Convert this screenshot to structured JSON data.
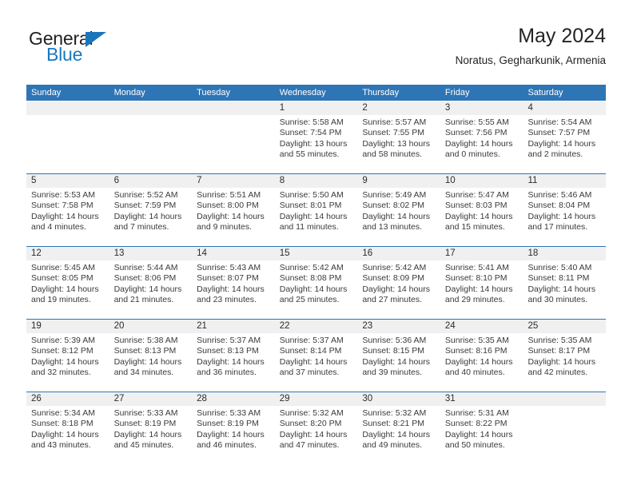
{
  "brand": {
    "name_part1": "General",
    "name_part2": "Blue",
    "triangle_color": "#1b75bb",
    "blue_color": "#1878bf"
  },
  "header": {
    "title": "May 2024",
    "location": "Noratus, Gegharkunik, Armenia"
  },
  "theme": {
    "header_bar": "#2e75b6",
    "number_band": "#f0f0f0",
    "cell_bg": "#ffffff",
    "row_divider": "#2e75b6",
    "text": "#3a3a3a"
  },
  "weekdays": [
    "Sunday",
    "Monday",
    "Tuesday",
    "Wednesday",
    "Thursday",
    "Friday",
    "Saturday"
  ],
  "weeks": [
    [
      {
        "day": "",
        "lines": []
      },
      {
        "day": "",
        "lines": []
      },
      {
        "day": "",
        "lines": []
      },
      {
        "day": "1",
        "lines": [
          "Sunrise: 5:58 AM",
          "Sunset: 7:54 PM",
          "Daylight: 13 hours",
          "and 55 minutes."
        ]
      },
      {
        "day": "2",
        "lines": [
          "Sunrise: 5:57 AM",
          "Sunset: 7:55 PM",
          "Daylight: 13 hours",
          "and 58 minutes."
        ]
      },
      {
        "day": "3",
        "lines": [
          "Sunrise: 5:55 AM",
          "Sunset: 7:56 PM",
          "Daylight: 14 hours",
          "and 0 minutes."
        ]
      },
      {
        "day": "4",
        "lines": [
          "Sunrise: 5:54 AM",
          "Sunset: 7:57 PM",
          "Daylight: 14 hours",
          "and 2 minutes."
        ]
      }
    ],
    [
      {
        "day": "5",
        "lines": [
          "Sunrise: 5:53 AM",
          "Sunset: 7:58 PM",
          "Daylight: 14 hours",
          "and 4 minutes."
        ]
      },
      {
        "day": "6",
        "lines": [
          "Sunrise: 5:52 AM",
          "Sunset: 7:59 PM",
          "Daylight: 14 hours",
          "and 7 minutes."
        ]
      },
      {
        "day": "7",
        "lines": [
          "Sunrise: 5:51 AM",
          "Sunset: 8:00 PM",
          "Daylight: 14 hours",
          "and 9 minutes."
        ]
      },
      {
        "day": "8",
        "lines": [
          "Sunrise: 5:50 AM",
          "Sunset: 8:01 PM",
          "Daylight: 14 hours",
          "and 11 minutes."
        ]
      },
      {
        "day": "9",
        "lines": [
          "Sunrise: 5:49 AM",
          "Sunset: 8:02 PM",
          "Daylight: 14 hours",
          "and 13 minutes."
        ]
      },
      {
        "day": "10",
        "lines": [
          "Sunrise: 5:47 AM",
          "Sunset: 8:03 PM",
          "Daylight: 14 hours",
          "and 15 minutes."
        ]
      },
      {
        "day": "11",
        "lines": [
          "Sunrise: 5:46 AM",
          "Sunset: 8:04 PM",
          "Daylight: 14 hours",
          "and 17 minutes."
        ]
      }
    ],
    [
      {
        "day": "12",
        "lines": [
          "Sunrise: 5:45 AM",
          "Sunset: 8:05 PM",
          "Daylight: 14 hours",
          "and 19 minutes."
        ]
      },
      {
        "day": "13",
        "lines": [
          "Sunrise: 5:44 AM",
          "Sunset: 8:06 PM",
          "Daylight: 14 hours",
          "and 21 minutes."
        ]
      },
      {
        "day": "14",
        "lines": [
          "Sunrise: 5:43 AM",
          "Sunset: 8:07 PM",
          "Daylight: 14 hours",
          "and 23 minutes."
        ]
      },
      {
        "day": "15",
        "lines": [
          "Sunrise: 5:42 AM",
          "Sunset: 8:08 PM",
          "Daylight: 14 hours",
          "and 25 minutes."
        ]
      },
      {
        "day": "16",
        "lines": [
          "Sunrise: 5:42 AM",
          "Sunset: 8:09 PM",
          "Daylight: 14 hours",
          "and 27 minutes."
        ]
      },
      {
        "day": "17",
        "lines": [
          "Sunrise: 5:41 AM",
          "Sunset: 8:10 PM",
          "Daylight: 14 hours",
          "and 29 minutes."
        ]
      },
      {
        "day": "18",
        "lines": [
          "Sunrise: 5:40 AM",
          "Sunset: 8:11 PM",
          "Daylight: 14 hours",
          "and 30 minutes."
        ]
      }
    ],
    [
      {
        "day": "19",
        "lines": [
          "Sunrise: 5:39 AM",
          "Sunset: 8:12 PM",
          "Daylight: 14 hours",
          "and 32 minutes."
        ]
      },
      {
        "day": "20",
        "lines": [
          "Sunrise: 5:38 AM",
          "Sunset: 8:13 PM",
          "Daylight: 14 hours",
          "and 34 minutes."
        ]
      },
      {
        "day": "21",
        "lines": [
          "Sunrise: 5:37 AM",
          "Sunset: 8:13 PM",
          "Daylight: 14 hours",
          "and 36 minutes."
        ]
      },
      {
        "day": "22",
        "lines": [
          "Sunrise: 5:37 AM",
          "Sunset: 8:14 PM",
          "Daylight: 14 hours",
          "and 37 minutes."
        ]
      },
      {
        "day": "23",
        "lines": [
          "Sunrise: 5:36 AM",
          "Sunset: 8:15 PM",
          "Daylight: 14 hours",
          "and 39 minutes."
        ]
      },
      {
        "day": "24",
        "lines": [
          "Sunrise: 5:35 AM",
          "Sunset: 8:16 PM",
          "Daylight: 14 hours",
          "and 40 minutes."
        ]
      },
      {
        "day": "25",
        "lines": [
          "Sunrise: 5:35 AM",
          "Sunset: 8:17 PM",
          "Daylight: 14 hours",
          "and 42 minutes."
        ]
      }
    ],
    [
      {
        "day": "26",
        "lines": [
          "Sunrise: 5:34 AM",
          "Sunset: 8:18 PM",
          "Daylight: 14 hours",
          "and 43 minutes."
        ]
      },
      {
        "day": "27",
        "lines": [
          "Sunrise: 5:33 AM",
          "Sunset: 8:19 PM",
          "Daylight: 14 hours",
          "and 45 minutes."
        ]
      },
      {
        "day": "28",
        "lines": [
          "Sunrise: 5:33 AM",
          "Sunset: 8:19 PM",
          "Daylight: 14 hours",
          "and 46 minutes."
        ]
      },
      {
        "day": "29",
        "lines": [
          "Sunrise: 5:32 AM",
          "Sunset: 8:20 PM",
          "Daylight: 14 hours",
          "and 47 minutes."
        ]
      },
      {
        "day": "30",
        "lines": [
          "Sunrise: 5:32 AM",
          "Sunset: 8:21 PM",
          "Daylight: 14 hours",
          "and 49 minutes."
        ]
      },
      {
        "day": "31",
        "lines": [
          "Sunrise: 5:31 AM",
          "Sunset: 8:22 PM",
          "Daylight: 14 hours",
          "and 50 minutes."
        ]
      },
      {
        "day": "",
        "lines": []
      }
    ]
  ]
}
